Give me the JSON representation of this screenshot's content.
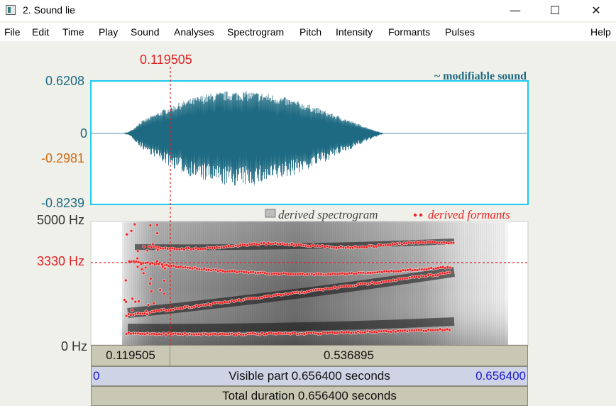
{
  "window": {
    "title": "2. Sound lie",
    "controls": {
      "minimize": "—",
      "maximize": "☐",
      "close": "✕"
    }
  },
  "menu": [
    "File",
    "Edit",
    "Time",
    "Play",
    "Sound",
    "Analyses",
    "Spectrogram",
    "Pitch",
    "Intensity",
    "Formants",
    "Pulses",
    "Help"
  ],
  "cursor": {
    "time": "0.119505",
    "freq": "3330 Hz"
  },
  "waveform": {
    "label": "~ modifiable sound",
    "y_max": "0.6208",
    "y_zero": "0",
    "y_cursor": "-0.2981",
    "y_min": "-0.8239"
  },
  "spectrogram": {
    "label": "derived spectrogram",
    "formants_label": "derived formants",
    "y_top": "5000 Hz",
    "y_bottom": "0 Hz"
  },
  "time_bars": {
    "left_value": "0.119505",
    "right_value": "0.536895",
    "visible_start": "0",
    "visible_label": "Visible part 0.656400 seconds",
    "visible_end": "0.656400",
    "total_label": "Total duration 0.656400 seconds"
  },
  "colors": {
    "waveform": "#1d6a82",
    "selection_border": "#1ec8f0",
    "cursor": "#e02222",
    "formant": "#ee2222",
    "bar": "#c9c8b4"
  }
}
